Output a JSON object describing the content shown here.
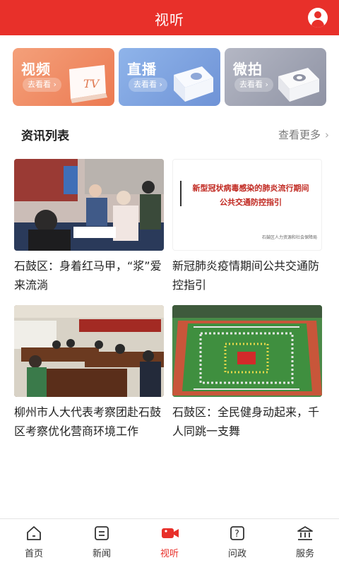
{
  "header": {
    "title": "视听"
  },
  "categories": [
    {
      "name": "视频",
      "action": "去看看",
      "badge": "TV",
      "icon": "tv-icon"
    },
    {
      "name": "直播",
      "action": "去看看",
      "icon": "live-icon"
    },
    {
      "name": "微拍",
      "action": "去看看",
      "icon": "camera-icon"
    }
  ],
  "section": {
    "title": "资讯列表",
    "more_label": "查看更多"
  },
  "news": [
    {
      "title": "石鼓区：身着红马甲，“浆”爱来流淌"
    },
    {
      "title": "新冠肺炎疫情期间公共交通防控指引",
      "image_heading_line1": "新型冠状病毒感染的肺炎流行期间",
      "image_heading_line2": "公共交通防控指引",
      "image_source": "石鼓区人力资源和社会保障局"
    },
    {
      "title": "柳州市人大代表考察团赴石鼓区考察优化营商环境工作"
    },
    {
      "title": "石鼓区：全民健身动起来，千人同跳一支舞"
    }
  ],
  "tabs": [
    {
      "label": "首页",
      "icon": "home-icon",
      "active": false
    },
    {
      "label": "新闻",
      "icon": "news-icon",
      "active": false
    },
    {
      "label": "视听",
      "icon": "video-camera-icon",
      "active": true
    },
    {
      "label": "问政",
      "icon": "question-icon",
      "active": false
    },
    {
      "label": "服务",
      "icon": "service-icon",
      "active": false
    }
  ],
  "colors": {
    "brand": "#e8302a",
    "active_tab": "#e8302a"
  }
}
